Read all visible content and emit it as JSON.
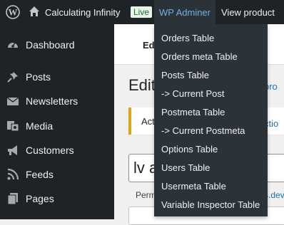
{
  "adminbar": {
    "site_title": "Calculating Infinity",
    "live_badge": "Live",
    "adminer": "WP Adminer",
    "view_product": "View product"
  },
  "sidebar": {
    "items": [
      {
        "label": "Dashboard",
        "icon": "dashboard-icon"
      },
      {
        "label": "Posts",
        "icon": "pushpin-icon"
      },
      {
        "label": "Newsletters",
        "icon": "envelope-icon"
      },
      {
        "label": "Media",
        "icon": "media-icon"
      },
      {
        "label": "Customers",
        "icon": "megaphone-icon"
      },
      {
        "label": "Feeds",
        "icon": "rss-icon"
      },
      {
        "label": "Pages",
        "icon": "page-icon"
      }
    ]
  },
  "content": {
    "edit_tab": "Ed",
    "heading": "Edit",
    "notice": "Act",
    "title_value": "lv a",
    "permalink": "Perm",
    "right_link_1": "pro",
    "right_link_2": "ctio",
    "right_link_3": "s.dev"
  },
  "adminer_menu": {
    "items": [
      "Orders Table",
      "Orders meta Table",
      "Posts Table",
      "-> Current Post",
      "Postmeta Table",
      "-> Current Postmeta",
      "Options Table",
      "Users Table",
      "Usermeta Table",
      "Variable Inspector Table"
    ]
  }
}
